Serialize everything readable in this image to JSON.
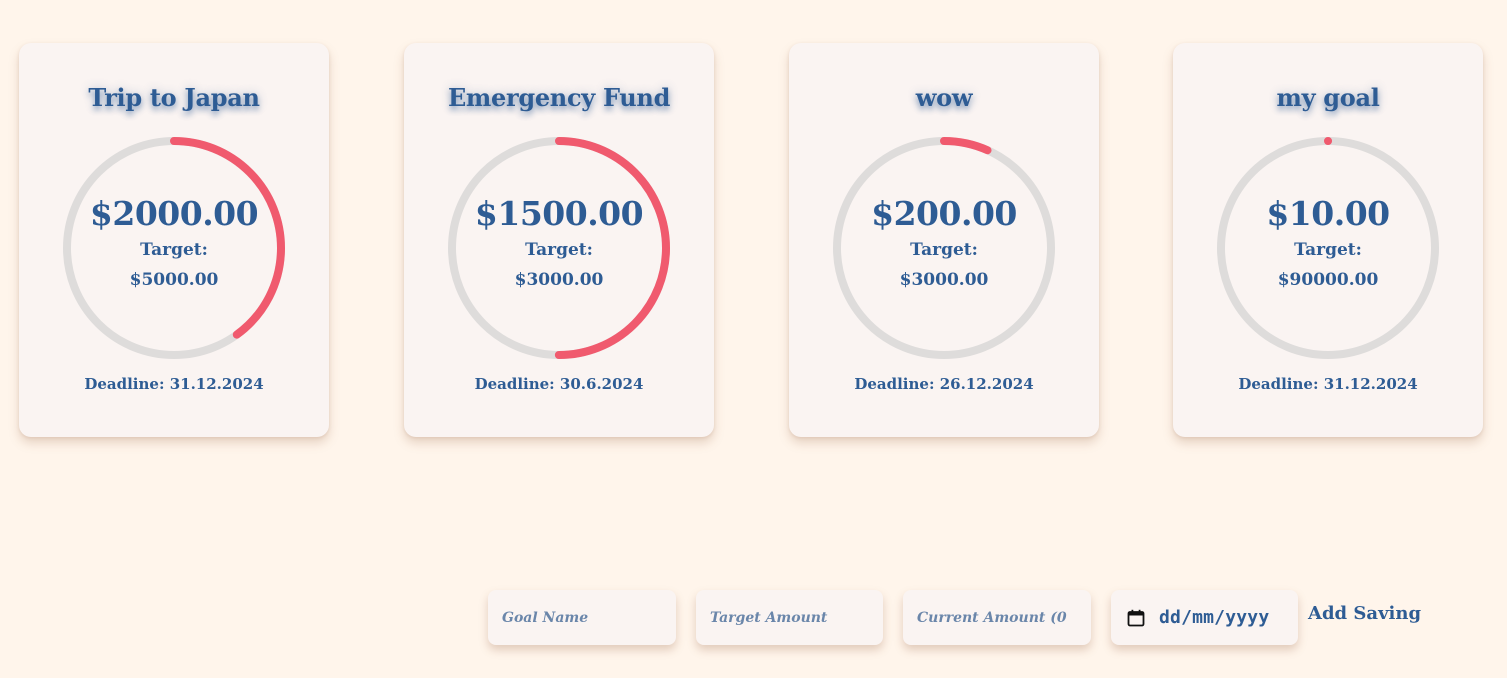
{
  "colors": {
    "background": "#fff5eb",
    "card": "#faf4f2",
    "text": "#2e5c94",
    "progress": "#f05a6e",
    "track": "#dedcdb"
  },
  "goals": [
    {
      "name": "Trip to Japan",
      "current": "$2000.00",
      "target_label": "Target:",
      "target": "$5000.00",
      "deadline": "Deadline: 31.12.2024",
      "progress": 0.4
    },
    {
      "name": "Emergency Fund",
      "current": "$1500.00",
      "target_label": "Target:",
      "target": "$3000.00",
      "deadline": "Deadline: 30.6.2024",
      "progress": 0.5
    },
    {
      "name": "wow",
      "current": "$200.00",
      "target_label": "Target:",
      "target": "$3000.00",
      "deadline": "Deadline: 26.12.2024",
      "progress": 0.0667
    },
    {
      "name": "my goal",
      "current": "$10.00",
      "target_label": "Target:",
      "target": "$90000.00",
      "deadline": "Deadline: 31.12.2024",
      "progress": 0.0001
    }
  ],
  "form": {
    "goal_name_placeholder": "Goal Name",
    "target_amount_placeholder": "Target Amount",
    "current_amount_placeholder": "Current Amount (0",
    "date_placeholder": "dd/mm/yyyy",
    "date_icon": "calendar-icon",
    "add_button_label": "Add Saving"
  }
}
